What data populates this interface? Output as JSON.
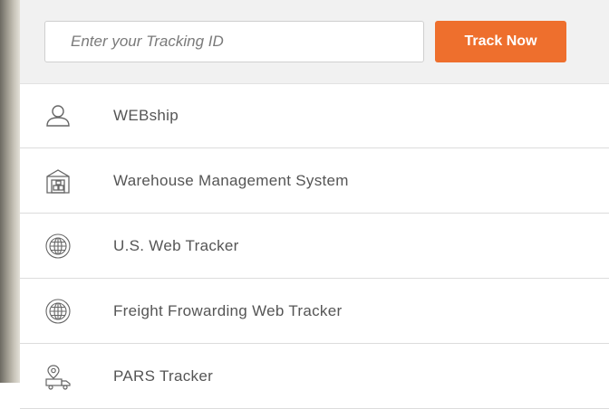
{
  "tracking": {
    "placeholder": "Enter your Tracking ID",
    "button_label": "Track Now",
    "accent_color": "#ee6f2d"
  },
  "menu": {
    "items": [
      {
        "label": "WEBship",
        "icon": "user-icon"
      },
      {
        "label": "Warehouse Management System",
        "icon": "warehouse-icon"
      },
      {
        "label": "U.S. Web Tracker",
        "icon": "globe-icon"
      },
      {
        "label": "Freight Frowarding Web Tracker",
        "icon": "globe-icon"
      },
      {
        "label": "PARS Tracker",
        "icon": "truck-location-icon"
      }
    ]
  }
}
